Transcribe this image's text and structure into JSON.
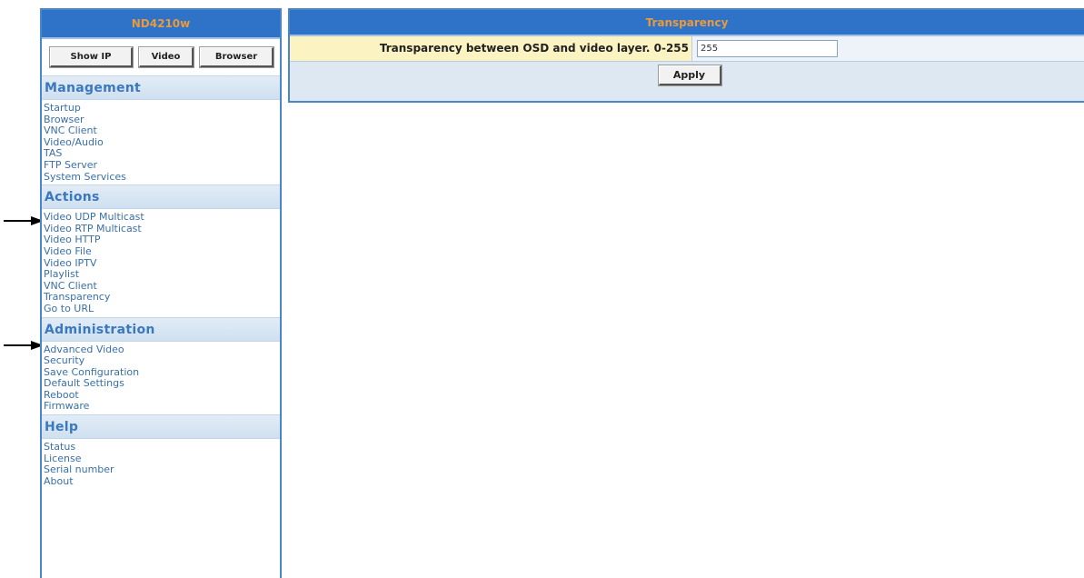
{
  "sidebar": {
    "title": "ND4210w",
    "buttons": {
      "show_ip": "Show IP",
      "video": "Video",
      "browser": "Browser"
    },
    "sections": [
      {
        "heading": "Management",
        "items": [
          "Startup",
          "Browser",
          "VNC Client",
          "Video/Audio",
          "TAS",
          "FTP Server",
          "System Services"
        ]
      },
      {
        "heading": "Actions",
        "items": [
          "Video UDP Multicast",
          "Video RTP Multicast",
          "Video HTTP",
          "Video File",
          "Video IPTV",
          "Playlist",
          "VNC Client",
          "Transparency",
          "Go to URL"
        ]
      },
      {
        "heading": "Administration",
        "items": [
          "Advanced Video",
          "Security",
          "Save Configuration",
          "Default Settings",
          "Reboot",
          "Firmware"
        ]
      },
      {
        "heading": "Help",
        "items": [
          "Status",
          "License",
          "Serial number",
          "About"
        ]
      }
    ]
  },
  "panel": {
    "title": "Transparency",
    "field_label": "Transparency between OSD and video layer. 0-255",
    "field_value": "255",
    "apply_label": "Apply"
  },
  "colors": {
    "header_blue": "#2f73c8",
    "header_text": "#e89a3c",
    "link_blue": "#3a6fa8",
    "label_bg": "#fbf4c2"
  }
}
